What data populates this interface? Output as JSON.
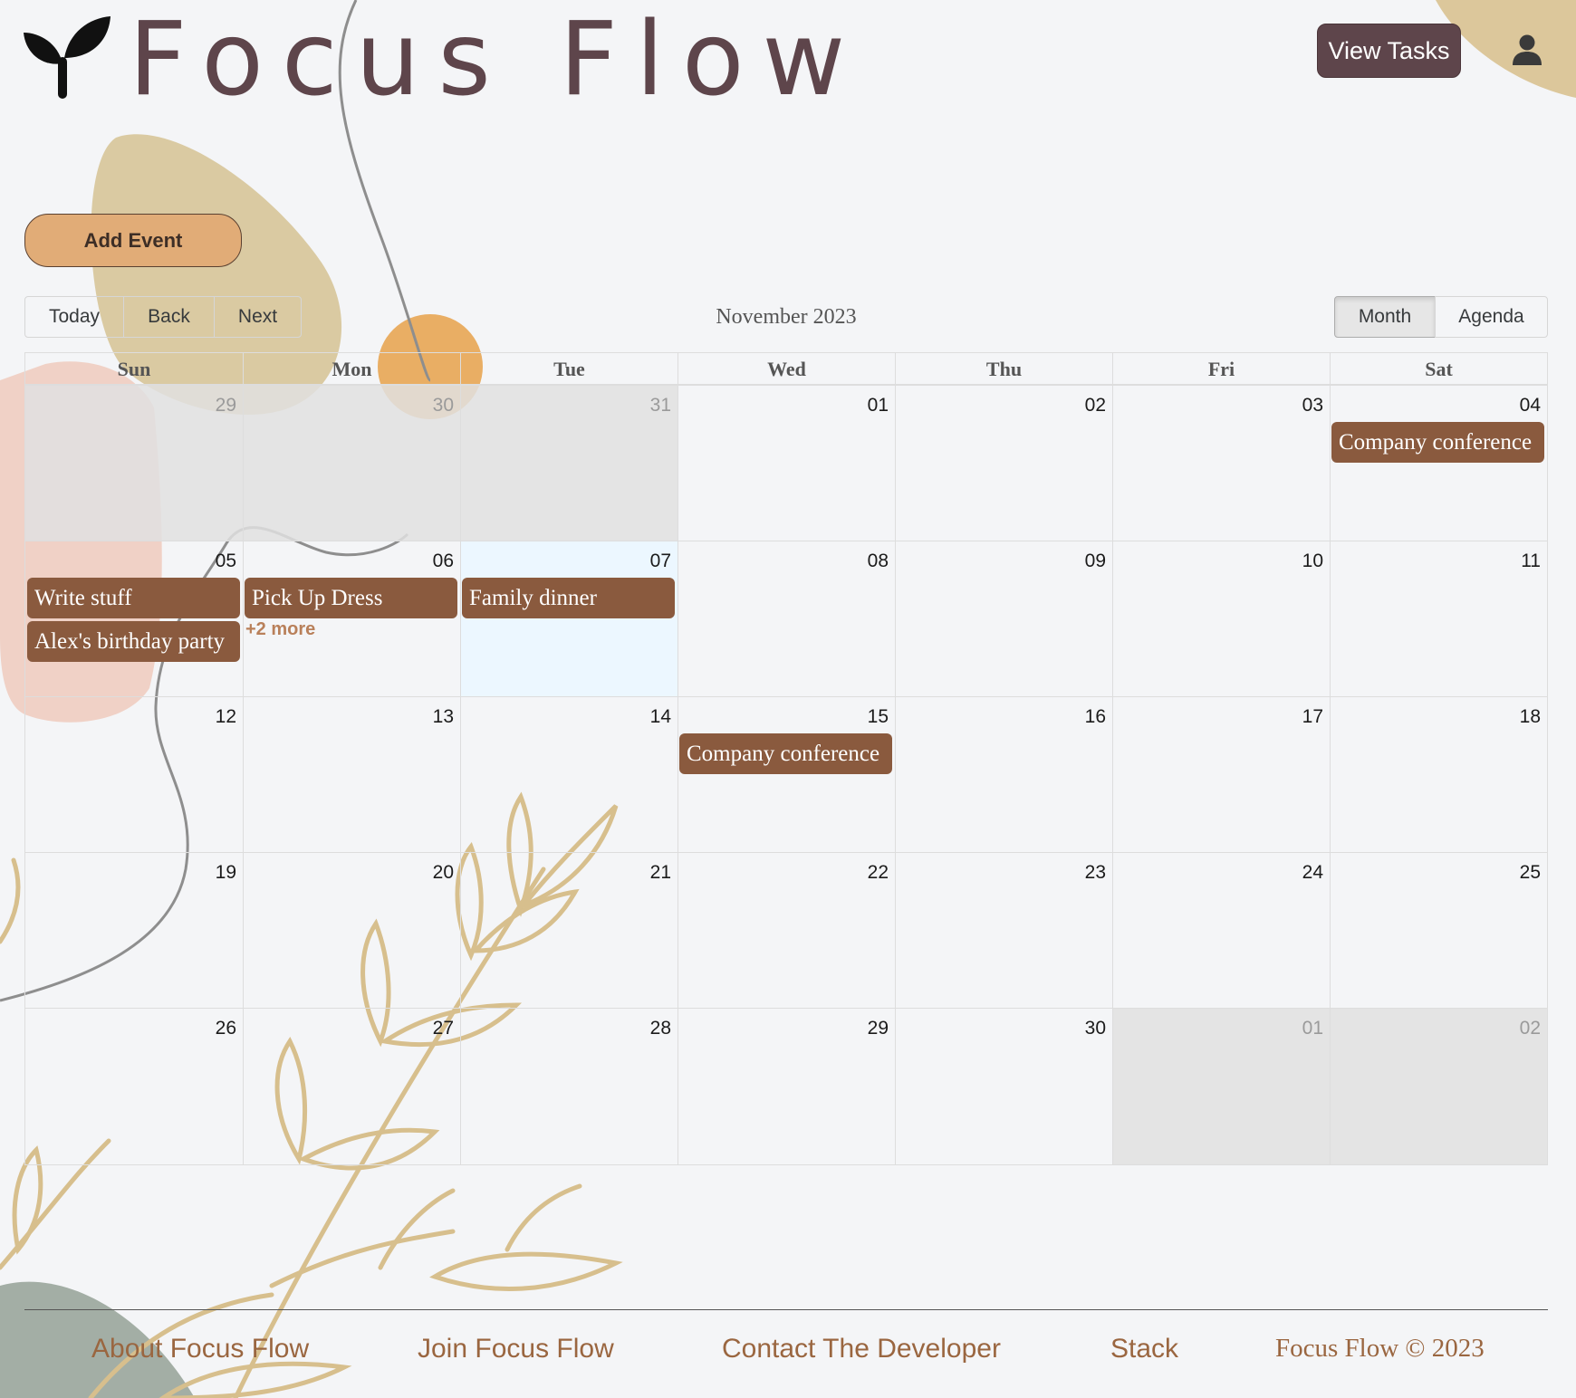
{
  "app": {
    "name": "Focus Flow",
    "view_tasks_label": "View Tasks",
    "add_event_label": "Add Event"
  },
  "toolbar": {
    "today_label": "Today",
    "back_label": "Back",
    "next_label": "Next",
    "month_label": "November 2023",
    "views": [
      "Month",
      "Agenda"
    ],
    "active_view": "Month"
  },
  "calendar": {
    "weekdays": [
      "Sun",
      "Mon",
      "Tue",
      "Wed",
      "Thu",
      "Fri",
      "Sat"
    ],
    "today": "07",
    "weeks": [
      {
        "dates": [
          "29",
          "30",
          "31",
          "01",
          "02",
          "03",
          "04"
        ],
        "off": [
          true,
          true,
          true,
          false,
          false,
          false,
          false
        ]
      },
      {
        "dates": [
          "05",
          "06",
          "07",
          "08",
          "09",
          "10",
          "11"
        ],
        "off": [
          false,
          false,
          false,
          false,
          false,
          false,
          false
        ]
      },
      {
        "dates": [
          "12",
          "13",
          "14",
          "15",
          "16",
          "17",
          "18"
        ],
        "off": [
          false,
          false,
          false,
          false,
          false,
          false,
          false
        ]
      },
      {
        "dates": [
          "19",
          "20",
          "21",
          "22",
          "23",
          "24",
          "25"
        ],
        "off": [
          false,
          false,
          false,
          false,
          false,
          false,
          false
        ]
      },
      {
        "dates": [
          "26",
          "27",
          "28",
          "29",
          "30",
          "01",
          "02"
        ],
        "off": [
          false,
          false,
          false,
          false,
          false,
          true,
          true
        ]
      }
    ],
    "events": [
      {
        "title": "Company conference",
        "week": 0,
        "day": 6,
        "slot": 0
      },
      {
        "title": "Write stuff",
        "week": 1,
        "day": 0,
        "slot": 0
      },
      {
        "title": "Alex's birthday party",
        "week": 1,
        "day": 0,
        "slot": 1
      },
      {
        "title": "Pick Up Dress",
        "week": 1,
        "day": 1,
        "slot": 0
      },
      {
        "title": "Family dinner",
        "week": 1,
        "day": 2,
        "slot": 0
      },
      {
        "title": "Company conference",
        "week": 2,
        "day": 3,
        "slot": 0
      }
    ],
    "more_links": [
      {
        "label": "+2 more",
        "week": 1,
        "day": 1
      }
    ]
  },
  "footer": {
    "links": [
      "About Focus Flow",
      "Join Focus Flow",
      "Contact The Developer",
      "Stack"
    ],
    "copyright": "Focus Flow © 2023"
  },
  "colors": {
    "brand": "#5e454b",
    "event": "#8a5a3e",
    "accent": "#e1ac77",
    "footer_link": "#9a6640",
    "today_bg": "#eaf6ff",
    "off_bg": "#e6e6e6"
  },
  "icons": {
    "logo": "sprout-icon",
    "user": "user-icon"
  }
}
